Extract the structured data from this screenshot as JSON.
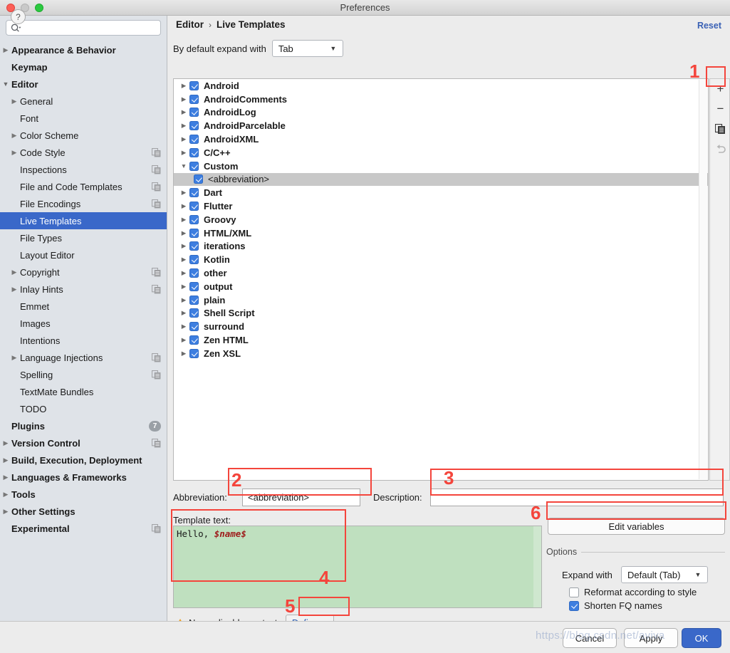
{
  "window": {
    "title": "Preferences",
    "traffic_lights": [
      "close-red",
      "minimize-gray",
      "zoom-green"
    ]
  },
  "sidebar": {
    "search": {
      "placeholder": "",
      "value": "",
      "icon": "search-icon"
    },
    "items": [
      {
        "label": "Appearance & Behavior",
        "level": 0,
        "arrow": "right",
        "bold": true
      },
      {
        "label": "Keymap",
        "level": 0,
        "arrow": "none",
        "bold": true
      },
      {
        "label": "Editor",
        "level": 0,
        "arrow": "down",
        "bold": true
      },
      {
        "label": "General",
        "level": 1,
        "arrow": "right"
      },
      {
        "label": "Font",
        "level": 1,
        "arrow": "none"
      },
      {
        "label": "Color Scheme",
        "level": 1,
        "arrow": "right"
      },
      {
        "label": "Code Style",
        "level": 1,
        "arrow": "right",
        "copy": true
      },
      {
        "label": "Inspections",
        "level": 1,
        "arrow": "none",
        "copy": true
      },
      {
        "label": "File and Code Templates",
        "level": 1,
        "arrow": "none",
        "copy": true
      },
      {
        "label": "File Encodings",
        "level": 1,
        "arrow": "none",
        "copy": true
      },
      {
        "label": "Live Templates",
        "level": 1,
        "arrow": "none",
        "selected": true
      },
      {
        "label": "File Types",
        "level": 1,
        "arrow": "none"
      },
      {
        "label": "Layout Editor",
        "level": 1,
        "arrow": "none"
      },
      {
        "label": "Copyright",
        "level": 1,
        "arrow": "right",
        "copy": true
      },
      {
        "label": "Inlay Hints",
        "level": 1,
        "arrow": "right",
        "copy": true
      },
      {
        "label": "Emmet",
        "level": 1,
        "arrow": "none"
      },
      {
        "label": "Images",
        "level": 1,
        "arrow": "none"
      },
      {
        "label": "Intentions",
        "level": 1,
        "arrow": "none"
      },
      {
        "label": "Language Injections",
        "level": 1,
        "arrow": "right",
        "copy": true
      },
      {
        "label": "Spelling",
        "level": 1,
        "arrow": "none",
        "copy": true
      },
      {
        "label": "TextMate Bundles",
        "level": 1,
        "arrow": "none"
      },
      {
        "label": "TODO",
        "level": 1,
        "arrow": "none"
      },
      {
        "label": "Plugins",
        "level": 0,
        "arrow": "none",
        "bold": true,
        "badge": "7"
      },
      {
        "label": "Version Control",
        "level": 0,
        "arrow": "right",
        "bold": true,
        "copy": true
      },
      {
        "label": "Build, Execution, Deployment",
        "level": 0,
        "arrow": "right",
        "bold": true
      },
      {
        "label": "Languages & Frameworks",
        "level": 0,
        "arrow": "right",
        "bold": true
      },
      {
        "label": "Tools",
        "level": 0,
        "arrow": "right",
        "bold": true
      },
      {
        "label": "Other Settings",
        "level": 0,
        "arrow": "right",
        "bold": true
      },
      {
        "label": "Experimental",
        "level": 0,
        "arrow": "none",
        "bold": true,
        "copy": true
      }
    ]
  },
  "main": {
    "breadcrumb": {
      "parent": "Editor",
      "separator": "›",
      "current": "Live Templates"
    },
    "reset_label": "Reset",
    "expand_with": {
      "label": "By default expand with",
      "value": "Tab"
    },
    "tree": [
      {
        "label": "Android",
        "checked": true,
        "arrow": "right"
      },
      {
        "label": "AndroidComments",
        "checked": true,
        "arrow": "right"
      },
      {
        "label": "AndroidLog",
        "checked": true,
        "arrow": "right"
      },
      {
        "label": "AndroidParcelable",
        "checked": true,
        "arrow": "right"
      },
      {
        "label": "AndroidXML",
        "checked": true,
        "arrow": "right"
      },
      {
        "label": "C/C++",
        "checked": true,
        "arrow": "right"
      },
      {
        "label": "Custom",
        "checked": true,
        "arrow": "down"
      },
      {
        "label": "<abbreviation>",
        "checked": true,
        "arrow": "none",
        "child": true,
        "selected": true
      },
      {
        "label": "Dart",
        "checked": true,
        "arrow": "right"
      },
      {
        "label": "Flutter",
        "checked": true,
        "arrow": "right"
      },
      {
        "label": "Groovy",
        "checked": true,
        "arrow": "right"
      },
      {
        "label": "HTML/XML",
        "checked": true,
        "arrow": "right"
      },
      {
        "label": "iterations",
        "checked": true,
        "arrow": "right"
      },
      {
        "label": "Kotlin",
        "checked": true,
        "arrow": "right"
      },
      {
        "label": "other",
        "checked": true,
        "arrow": "right"
      },
      {
        "label": "output",
        "checked": true,
        "arrow": "right"
      },
      {
        "label": "plain",
        "checked": true,
        "arrow": "right"
      },
      {
        "label": "Shell Script",
        "checked": true,
        "arrow": "right"
      },
      {
        "label": "surround",
        "checked": true,
        "arrow": "right"
      },
      {
        "label": "Zen HTML",
        "checked": true,
        "arrow": "right"
      },
      {
        "label": "Zen XSL",
        "checked": true,
        "arrow": "right"
      }
    ],
    "toolbar": {
      "add": "+",
      "remove": "−",
      "duplicate": "copy-icon",
      "revert": "undo-icon"
    },
    "form": {
      "abbreviation_label": "Abbreviation:",
      "abbreviation_value": "<abbreviation>",
      "description_label": "Description:",
      "description_value": "",
      "template_text_label": "Template text:",
      "template_text_plain": "Hello,",
      "template_text_variable": "$name$",
      "context_warning": "No applicable contexts",
      "define_label": "Define",
      "define_caret": "⌄"
    },
    "options": {
      "edit_variables_label": "Edit variables",
      "section_title": "Options",
      "expand_with_label": "Expand with",
      "expand_with_value": "Default (Tab)",
      "reformat_label": "Reformat according to style",
      "reformat_checked": false,
      "shorten_label": "Shorten FQ names",
      "shorten_checked": true
    }
  },
  "footer": {
    "help": "?",
    "cancel": "Cancel",
    "apply": "Apply",
    "ok": "OK"
  },
  "annotations": [
    {
      "num": "1",
      "target": "add-template-button"
    },
    {
      "num": "2",
      "target": "abbreviation-field"
    },
    {
      "num": "3",
      "target": "description-field"
    },
    {
      "num": "4",
      "target": "template-text-area"
    },
    {
      "num": "5",
      "target": "define-button"
    },
    {
      "num": "6",
      "target": "edit-variables-button"
    }
  ],
  "watermark": "https://blog.csdn.net/aviva",
  "colors": {
    "accent": "#3a68c9",
    "annotation": "#f4453c",
    "template_bg": "#bfe0bf",
    "sidebar_bg": "#dfe3e8"
  }
}
